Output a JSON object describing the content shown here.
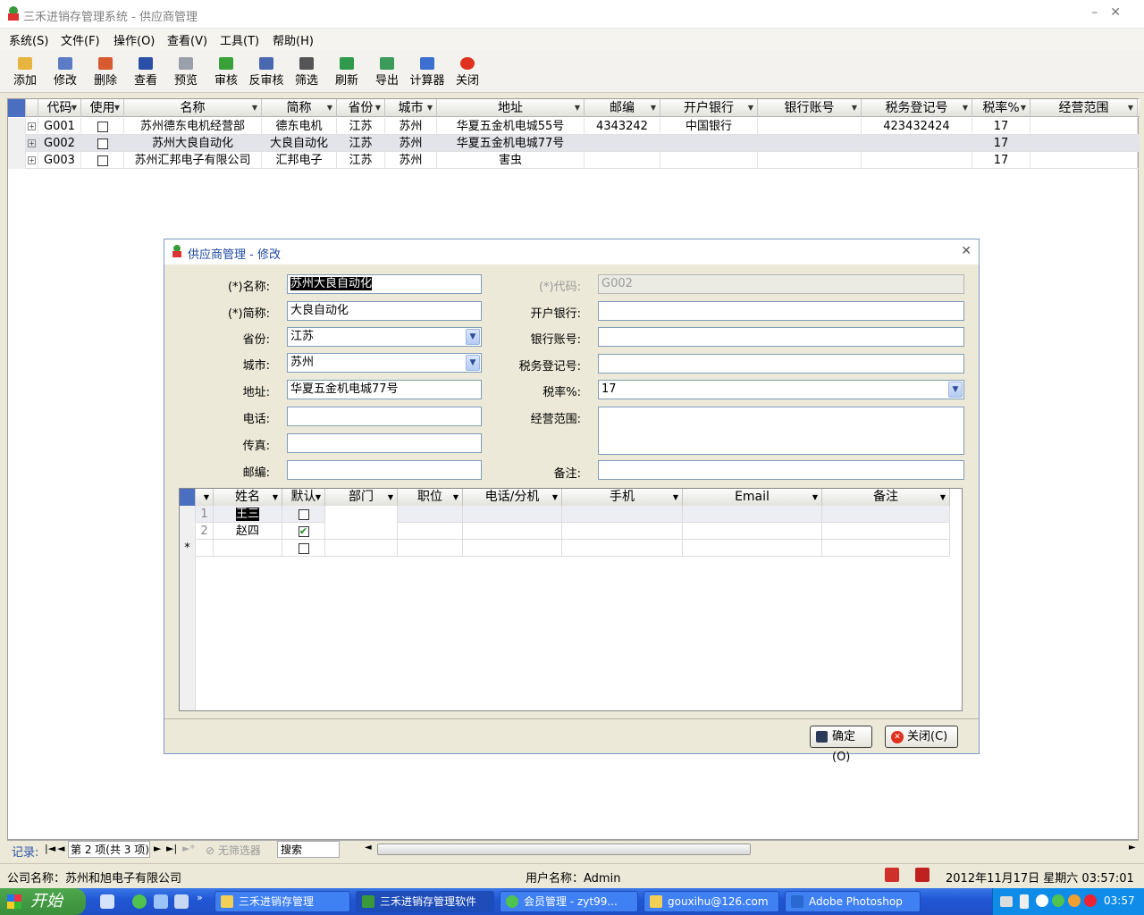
{
  "window": {
    "title": "三禾进销存管理系统 - 供应商管理"
  },
  "menu": [
    "系统(S)",
    "文件(F)",
    "操作(O)",
    "查看(V)",
    "工具(T)",
    "帮助(H)"
  ],
  "toolbar": [
    {
      "label": "添加",
      "icon": "add-icon",
      "color": "#e8b440"
    },
    {
      "label": "修改",
      "icon": "edit-icon",
      "color": "#5b7cc4"
    },
    {
      "label": "删除",
      "icon": "delete-icon",
      "color": "#d85a30"
    },
    {
      "label": "查看",
      "icon": "view-icon",
      "color": "#2a4fa8"
    },
    {
      "label": "预览",
      "icon": "preview-icon",
      "color": "#9aa0aa"
    },
    {
      "label": "审核",
      "icon": "approve-icon",
      "color": "#3aa03a"
    },
    {
      "label": "反审核",
      "icon": "unapprove-icon",
      "color": "#4a68b0"
    },
    {
      "label": "筛选",
      "icon": "filter-icon",
      "color": "#555555"
    },
    {
      "label": "刷新",
      "icon": "refresh-icon",
      "color": "#2f9a4c"
    },
    {
      "label": "导出",
      "icon": "export-icon",
      "color": "#3c9a5a"
    },
    {
      "label": "计算器",
      "icon": "calculator-icon",
      "color": "#3b6fd0"
    },
    {
      "label": "关闭",
      "icon": "close-icon",
      "color": "#e0301e"
    }
  ],
  "grid": {
    "columns": [
      "代码",
      "使用",
      "名称",
      "简称",
      "省份",
      "城市",
      "地址",
      "邮编",
      "开户银行",
      "银行账号",
      "税务登记号",
      "税率%",
      "经营范围"
    ],
    "rows": [
      {
        "code": "G001",
        "name": "苏州德东电机经营部",
        "short": "德东电机",
        "province": "江苏",
        "city": "苏州",
        "address": "华夏五金机电城55号",
        "zip": "4343242",
        "bank": "中国银行",
        "account": "",
        "tax_no": "423432424",
        "rate": "17",
        "scope": ""
      },
      {
        "code": "G002",
        "name": "苏州大良自动化",
        "short": "大良自动化",
        "province": "江苏",
        "city": "苏州",
        "address": "华夏五金机电城77号",
        "zip": "",
        "bank": "",
        "account": "",
        "tax_no": "",
        "rate": "17",
        "scope": ""
      },
      {
        "code": "G003",
        "name": "苏州汇邦电子有限公司",
        "short": "汇邦电子",
        "province": "江苏",
        "city": "苏州",
        "address": "害虫",
        "zip": "",
        "bank": "",
        "account": "",
        "tax_no": "",
        "rate": "17",
        "scope": ""
      }
    ]
  },
  "navigator": {
    "label": "记录:",
    "position": "第 2 项(共 3 项)",
    "filter": "无筛选器",
    "search": "搜索"
  },
  "status": {
    "company": "公司名称：苏州和旭电子有限公司",
    "user": "用户名称：Admin",
    "datetime": "2012年11月17日 星期六 03:57:01"
  },
  "dialog": {
    "title": "供应商管理 - 修改",
    "name_label": "(*)名称:",
    "name": "苏州大良自动化",
    "short_label": "(*)简称:",
    "short": "大良自动化",
    "province_label": "省份:",
    "province": "江苏",
    "city_label": "城市:",
    "city": "苏州",
    "address_label": "地址:",
    "address": "华夏五金机电城77号",
    "phone_label": "电话:",
    "phone": "",
    "fax_label": "传真:",
    "fax": "",
    "zip_label": "邮编:",
    "zip": "",
    "code_label": "(*)代码:",
    "code": "G002",
    "bank_label": "开户银行:",
    "bank": "",
    "account_label": "银行账号:",
    "account": "",
    "tax_label": "税务登记号:",
    "tax": "",
    "rate_label": "税率%:",
    "rate": "17",
    "scope_label": "经营范围:",
    "scope": "",
    "note_label": "备注:",
    "note": "",
    "contacts": {
      "columns": [
        "姓名",
        "默认",
        "部门",
        "职位",
        "电话/分机",
        "手机",
        "Email",
        "备注"
      ],
      "rows": [
        {
          "num": "1",
          "name": "王三",
          "default": false
        },
        {
          "num": "2",
          "name": "赵四",
          "default": true
        }
      ],
      "new_row_marker": "*"
    },
    "ok": "确定(O)",
    "close": "关闭(C)"
  },
  "taskbar": {
    "start": "开始",
    "tasks": [
      "三禾进销存管理",
      "三禾进销存管理软件",
      "会员管理 - zyt99...",
      "gouxihu@126.com",
      "Adobe Photoshop"
    ],
    "clock": "03:57"
  }
}
